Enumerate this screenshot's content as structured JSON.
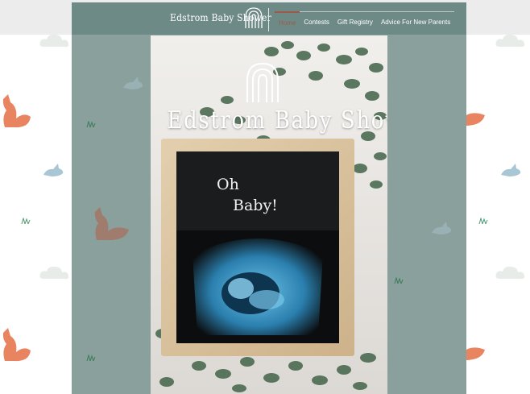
{
  "header": {
    "site_title": "Edstrom Baby Shower",
    "nav": [
      {
        "label": "Home",
        "active": true
      },
      {
        "label": "Contests",
        "active": false
      },
      {
        "label": "Gift Registry",
        "active": false
      },
      {
        "label": "Advice For New Parents",
        "active": false
      }
    ]
  },
  "hero": {
    "title": "Edstrom Baby Shower",
    "board_line1": "Oh",
    "board_line2": "Baby!"
  },
  "colors": {
    "panel": "#89a09d",
    "header_bar": "#6d8a87",
    "nav_active": "#9b5a4b",
    "fox": "#e8845f",
    "rabbit": "#a9c6d4"
  },
  "icons": [
    "rainbow-logo-icon",
    "fox-icon",
    "rabbit-icon",
    "cloud-icon",
    "grass-icon"
  ]
}
